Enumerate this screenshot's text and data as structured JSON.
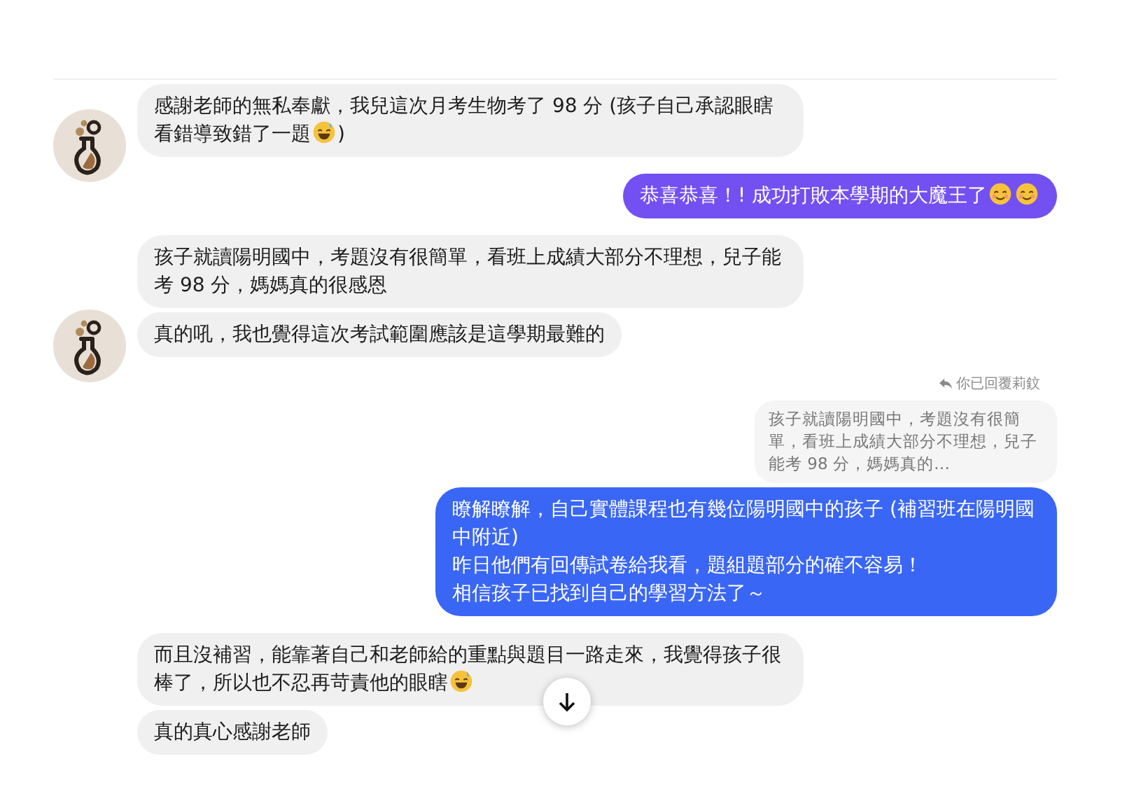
{
  "groups": [
    {
      "kind": "incoming",
      "show_avatar": true,
      "messages": [
        {
          "paragraphs": [
            [
              {
                "kind": "text",
                "text": "感謝老師的無私奉獻，我兒這次月考生物考了 98 分 (孩子自己承認眼瞎看錯導致錯了一題"
              },
              {
                "kind": "sweat"
              },
              {
                "kind": "text",
                "text": ")"
              }
            ]
          ]
        }
      ]
    },
    {
      "kind": "outgoing",
      "messages": [
        {
          "color": "#7350f1",
          "paragraphs": [
            [
              {
                "kind": "text",
                "text": "恭喜恭喜！! 成功打敗本學期的大魔王了"
              },
              {
                "kind": "smile"
              },
              {
                "kind": "smile"
              }
            ]
          ]
        }
      ]
    },
    {
      "kind": "incoming",
      "show_avatar": true,
      "messages": [
        {
          "paragraphs": [
            [
              {
                "kind": "text",
                "text": "孩子就讀陽明國中，考題沒有很簡單，看班上成績大部分不理想，兒子能考 98 分，媽媽真的很感恩"
              }
            ]
          ]
        },
        {
          "paragraphs": [
            [
              {
                "kind": "text",
                "text": "真的吼，我也覺得這次考試範圍應該是這學期最難的"
              }
            ]
          ]
        }
      ]
    },
    {
      "kind": "outgoing",
      "reply": {
        "label": "你已回覆莉鈫",
        "quote": "孩子就讀陽明國中，考題沒有很簡單，看班上成績大部分不理想，兒子能考 98 分，媽媽真的…"
      },
      "messages": [
        {
          "color": "#3a66f5",
          "paragraphs": [
            [
              {
                "kind": "text",
                "text": "瞭解瞭解，自己實體課程也有幾位陽明國中的孩子 (補習班在陽明國中附近)"
              }
            ],
            [
              {
                "kind": "text",
                "text": "昨日他們有回傳試卷給我看，題組題部分的確不容易！"
              }
            ],
            [
              {
                "kind": "text",
                "text": "相信孩子已找到自己的學習方法了～"
              }
            ]
          ]
        }
      ]
    },
    {
      "kind": "incoming",
      "show_avatar": false,
      "messages": [
        {
          "paragraphs": [
            [
              {
                "kind": "text",
                "text": "而且沒補習，能靠著自己和老師給的重點與題目一路走來，我覺得孩子很棒了，所以也不忍再苛責他的眼瞎"
              },
              {
                "kind": "sweat"
              }
            ]
          ]
        },
        {
          "paragraphs": [
            [
              {
                "kind": "text",
                "text": "真的真心感謝老師"
              }
            ]
          ]
        }
      ]
    }
  ]
}
